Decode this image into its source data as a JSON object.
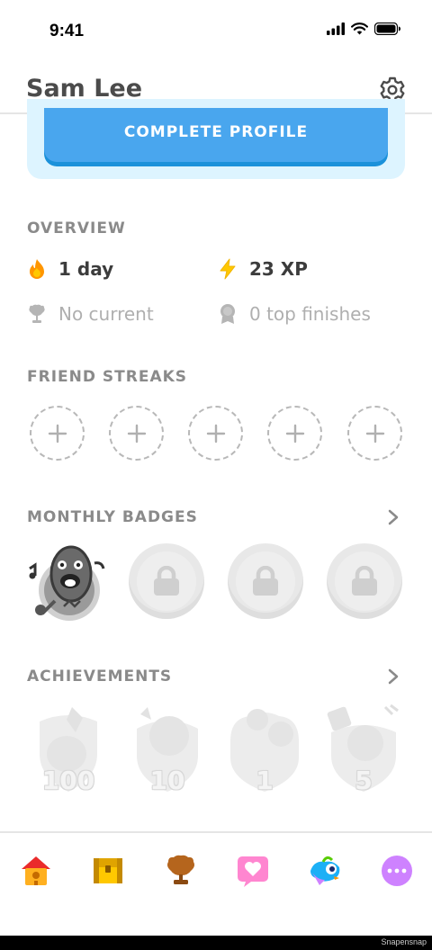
{
  "status": {
    "time": "9:41"
  },
  "header": {
    "title": "Sam Lee"
  },
  "profile": {
    "complete_label": "COMPLETE PROFILE"
  },
  "overview": {
    "title": "OVERVIEW",
    "streak": "1 day",
    "xp": "23 XP",
    "league": "No current",
    "top_finishes": "0 top finishes"
  },
  "friend_streaks": {
    "title": "FRIEND STREAKS",
    "slots": 5
  },
  "monthly_badges": {
    "title": "MONTHLY BADGES"
  },
  "achievements": {
    "title": "ACHIEVEMENTS",
    "items": [
      {
        "value": "100"
      },
      {
        "value": "10"
      },
      {
        "value": "1"
      },
      {
        "value": "5"
      }
    ]
  },
  "tabbar": {
    "icons": [
      "home-icon",
      "chest-icon",
      "league-icon",
      "heart-icon",
      "duo-icon",
      "more-icon"
    ]
  },
  "footer": {
    "watermark": "Snapensnap"
  },
  "colors": {
    "accent": "#49a6ee",
    "card": "#ddf4ff",
    "flame": "#ff9600",
    "xp": "#ffc800"
  }
}
